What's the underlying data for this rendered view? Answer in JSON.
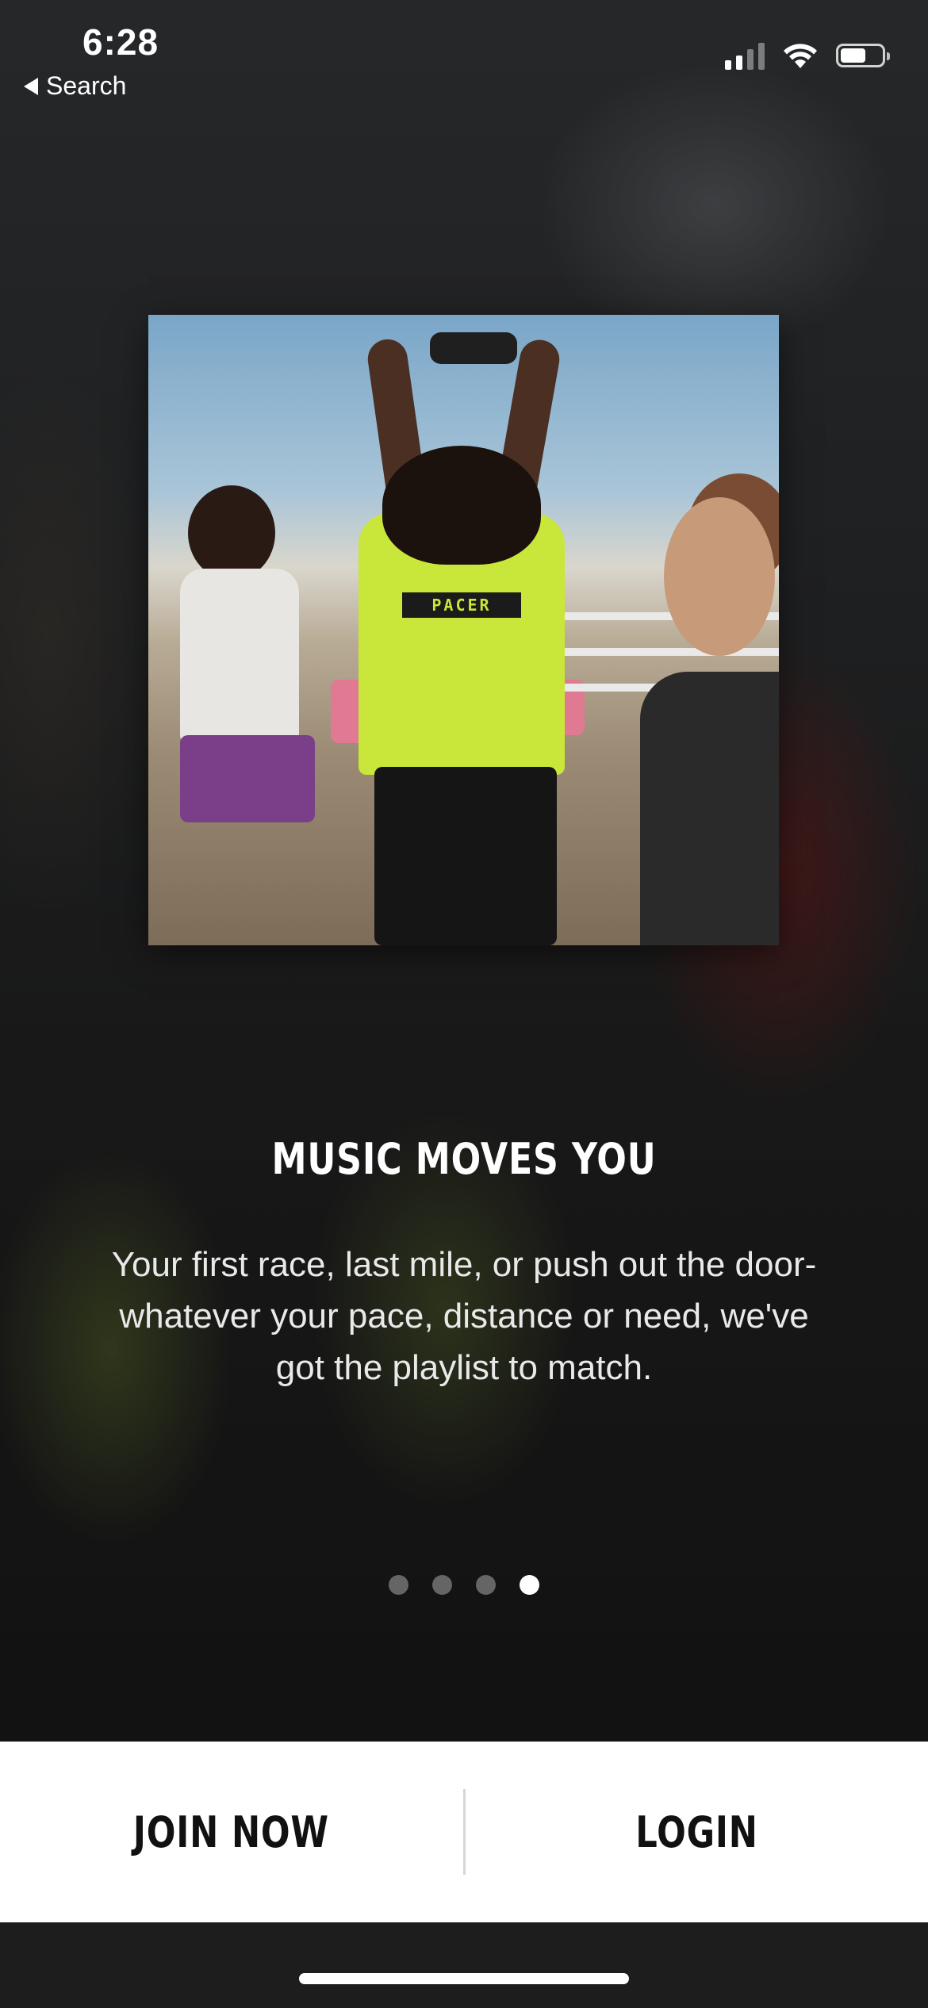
{
  "status_bar": {
    "time": "6:28",
    "back_label": "Search",
    "battery_level": 0.62,
    "signal_bars_active": 2,
    "signal_bars_total": 4
  },
  "onboarding": {
    "title": "MUSIC MOVES YOU",
    "description": "Your first race, last mile, or push out the door-whatever your pace, distance or need, we've got the playlist to match.",
    "pages_total": 4,
    "current_page": 4,
    "hero_shirt_text": "PACER"
  },
  "actions": {
    "join_label": "JOIN NOW",
    "login_label": "LOGIN"
  },
  "colors": {
    "action_bar_bg": "#ffffff",
    "action_text": "#111111",
    "dot_active": "#ffffff",
    "dot_inactive": "rgba(255,255,255,0.35)"
  },
  "icons": {
    "back": "back-triangle-icon",
    "signal": "cellular-signal-icon",
    "wifi": "wifi-icon",
    "battery": "battery-icon"
  }
}
